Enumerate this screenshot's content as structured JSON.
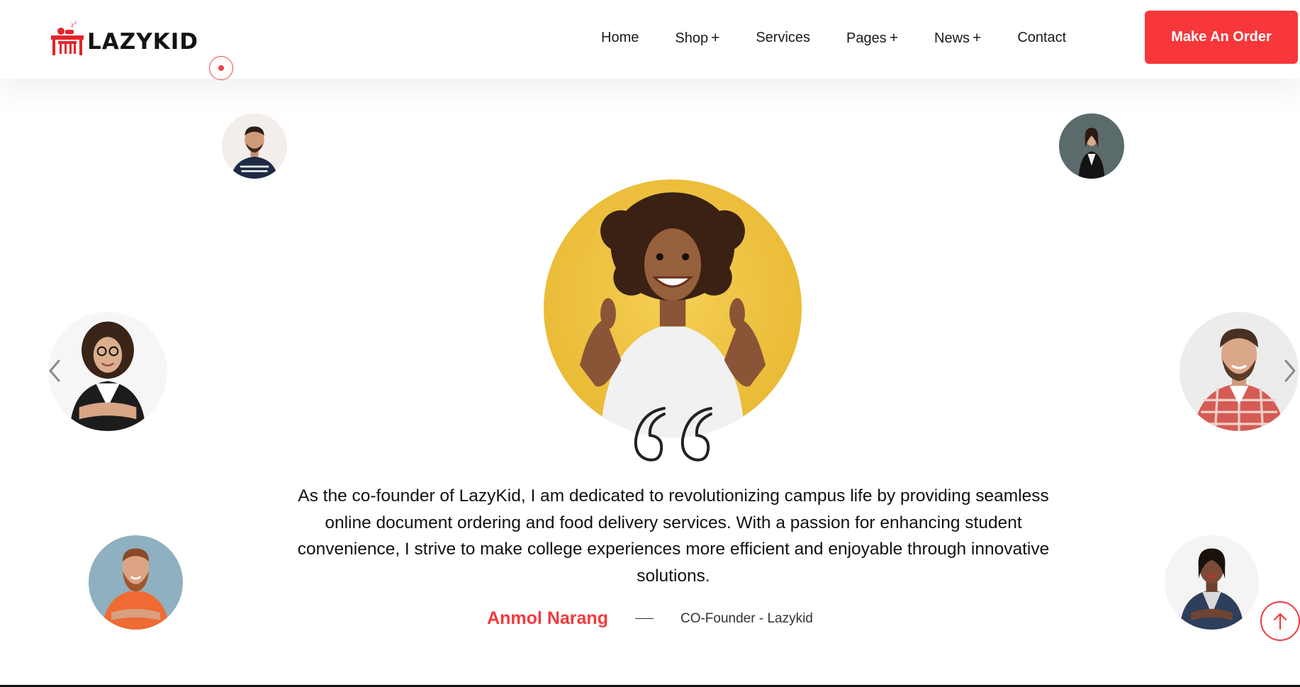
{
  "brand": {
    "name": "LAZYKID",
    "accent_color": "#f7373a"
  },
  "nav": {
    "items": [
      {
        "label": "Home",
        "has_submenu": false
      },
      {
        "label": "Shop",
        "has_submenu": true
      },
      {
        "label": "Services",
        "has_submenu": false
      },
      {
        "label": "Pages",
        "has_submenu": true
      },
      {
        "label": "News",
        "has_submenu": true
      },
      {
        "label": "Contact",
        "has_submenu": false
      }
    ],
    "submenu_indicator": "+",
    "cta_label": "Make An Order"
  },
  "testimonial": {
    "quote": "As the co-founder of LazyKid, I am dedicated to revolutionizing campus life by providing seamless online document ordering and food delivery services. With a passion for enhancing student convenience, I strive to make college experiences more efficient and enjoyable through innovative solutions.",
    "author_name": "Anmol Narang",
    "author_role": "CO-Founder - Lazykid"
  },
  "icons": {
    "prev": "chevron-left-icon",
    "next": "chevron-right-icon",
    "quote": "quote-icon",
    "scroll_top": "arrow-up-icon"
  }
}
